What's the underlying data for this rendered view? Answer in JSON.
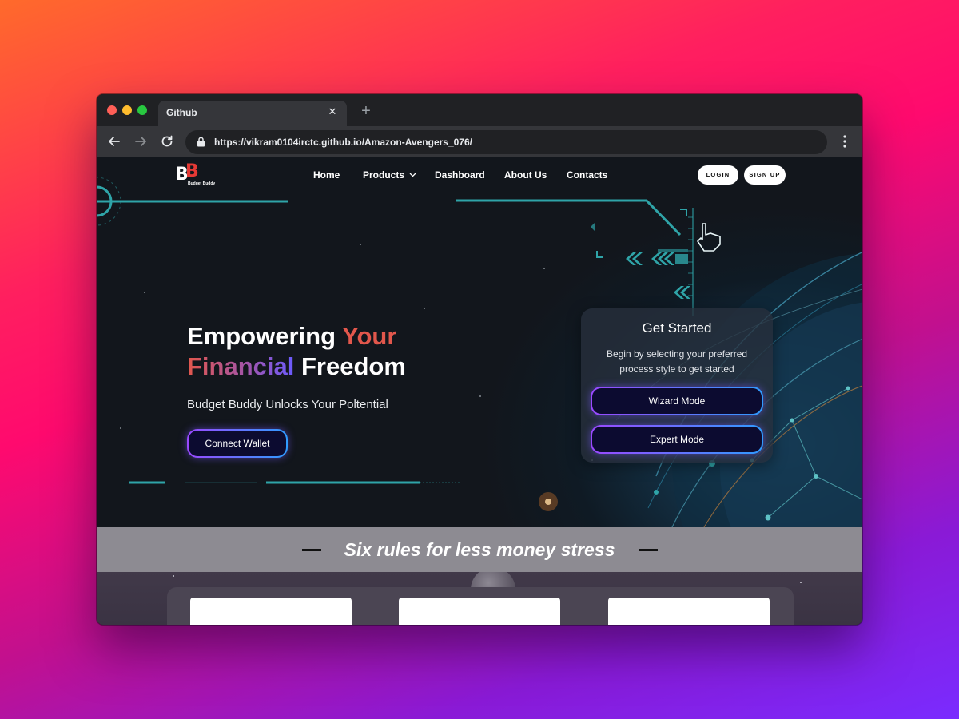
{
  "browser": {
    "tab_title": "Github",
    "tab_close": "✕",
    "new_tab": "+",
    "url": "https://vikram0104irctc.github.io/Amazon-Avengers_076/",
    "icons": [
      "back-arrow-icon",
      "forward-arrow-icon",
      "reload-icon",
      "lock-icon",
      "more-menu-icon",
      "close-icon",
      "plus-icon"
    ]
  },
  "site": {
    "logo": {
      "letters": "BB",
      "text": "Budget Buddy"
    },
    "nav": [
      {
        "label": "Home"
      },
      {
        "label": "Products",
        "icon": "chevron-down-icon"
      },
      {
        "label": "Dashboard"
      },
      {
        "label": "About Us"
      },
      {
        "label": "Contacts"
      }
    ],
    "auth": {
      "login": "LOGIN",
      "signup": "SIGN UP"
    },
    "hero": {
      "line1_a": "Empowering ",
      "line1_b": "Your",
      "line2_a": "Financial",
      "line2_b": " Freedom",
      "subtitle": "Budget Buddy Unlocks Your Poltential",
      "cta": "Connect Wallet"
    },
    "get_started": {
      "title": "Get Started",
      "text": "Begin by selecting your preferred process style to get started",
      "wizard": "Wizard Mode",
      "expert": "Expert Mode"
    },
    "rules": {
      "title": "Six rules for less money stress"
    }
  },
  "colors": {
    "accent_red": "#e2574c",
    "accent_purple": "#6b5bff",
    "teal_lines": "#2fa4a8",
    "button_bg": "#0c0b30",
    "band_bg": "#8d8b92"
  }
}
